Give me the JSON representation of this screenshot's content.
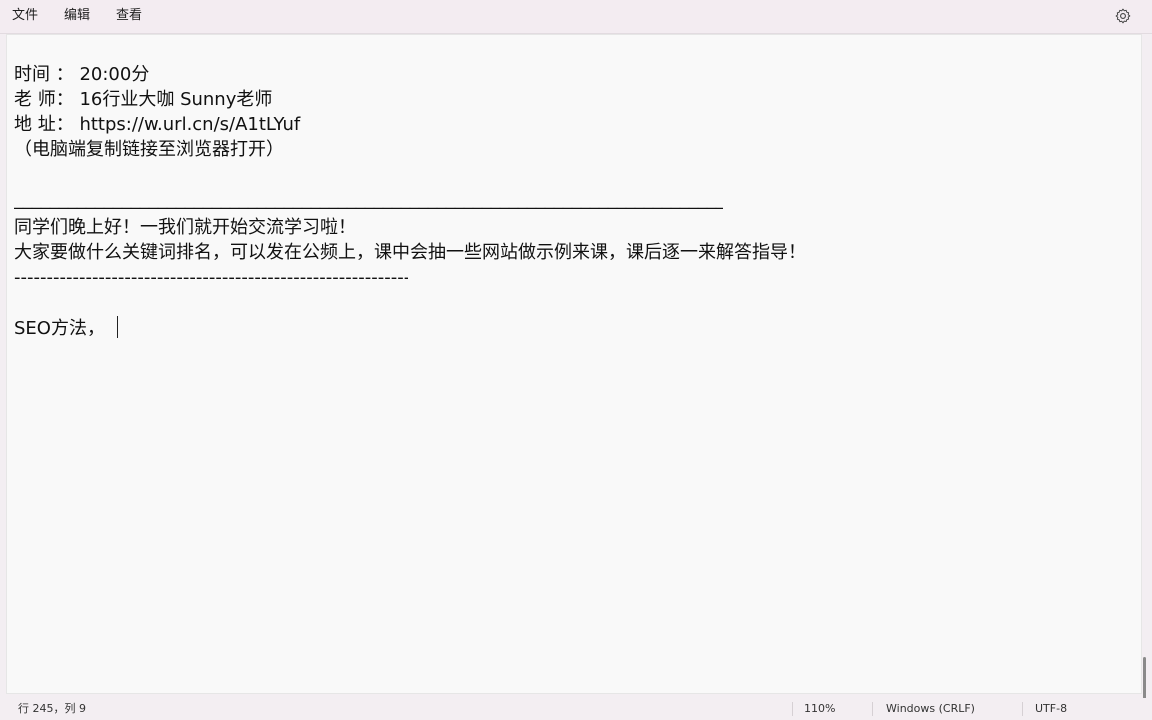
{
  "menu": {
    "file": "文件",
    "edit": "编辑",
    "view": "查看"
  },
  "settings_icon": "gear-icon",
  "document": {
    "lines": [
      "时间 ： 20:00分",
      "老 师： 16行业大咖 Sunny老师",
      "地 址： https://w.url.cn/s/A1tLYuf",
      "（电脑端复制链接至浏览器打开）",
      "_________________________________________________________________________________________________________",
      "同学们晚上好！一我们就开始交流学习啦！",
      "大家要做什么关键词排名，可以发在公频上，课中会抽一些网站做示例来课，课后逐一来解答指导！",
      "---------------------------------------------------------------------------------------------",
      "SEO方法，"
    ]
  },
  "status": {
    "position": "行 245，列 9",
    "zoom": "110%",
    "line_ending": "Windows (CRLF)",
    "encoding": "UTF-8"
  },
  "colors": {
    "chrome_bg": "#f3eef2",
    "editor_bg": "#f9f9f9",
    "text": "#111111"
  }
}
